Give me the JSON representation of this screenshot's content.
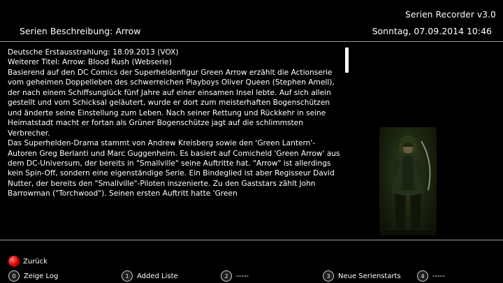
{
  "header": {
    "app_name": "Serien Recorder v3.0",
    "title": "Serien Beschreibung: Arrow",
    "datetime": "Sonntag, 07.09.2014  10:46"
  },
  "description": {
    "text": "Deutsche Erstausstrahlung: 18.09.2013 (VOX)\nWeiterer Titel: Arrow: Blood Rush (Webserie)\nBasierend auf den DC Comics der Superheldenfigur Green Arrow erzählt die Actionserie vom geheimen Doppelleben des schwerreichen Playboys Oliver Queen (Stephen Amell), der nach einem Schiffsunglück fünf Jahre auf einer einsamen Insel lebte. Auf sich allein gestellt und vom Schicksal geläutert, wurde er dort zum meisterhaften Bogenschützen und änderte seine Einstellung zum Leben. Nach seiner Rettung und Rückkehr in seine Heimatstadt macht er fortan als Grüner Bogenschütze jagt auf die schlimmsten Verbrecher.\nDas Superhelden-Drama stammt von Andrew Kreisberg sowie den 'Green Lantern'-Autoren Greg Berlanti und Marc Guggenheim. Es basiert auf Comicheld 'Green Arrow' aus dem DC-Universum, der bereits in \"Smallville\" seine Auftritte hat. \"Arrow\" ist allerdings kein Spin-Off, sondern eine eigenständige Serie. Ein Bindeglied ist aber Regisseur David Nutter, der bereits den \"Smallville\"-Piloten inszenierte. Zu den Gaststars zählt John Barrowman (\"Torchwood\"). Seinen ersten Auftritt hatte 'Green"
  },
  "scroll": {
    "position_fraction": 0.0
  },
  "footer": {
    "red_key": {
      "label": "Zurück",
      "color": "#d30000"
    },
    "keys": [
      {
        "number": "0",
        "label": "Zeige Log"
      },
      {
        "number": "1",
        "label": "Added Liste"
      },
      {
        "number": "2",
        "label": "-----"
      },
      {
        "number": "3",
        "label": "Neue Serienstarts"
      },
      {
        "number": "4",
        "label": "-----"
      }
    ]
  }
}
